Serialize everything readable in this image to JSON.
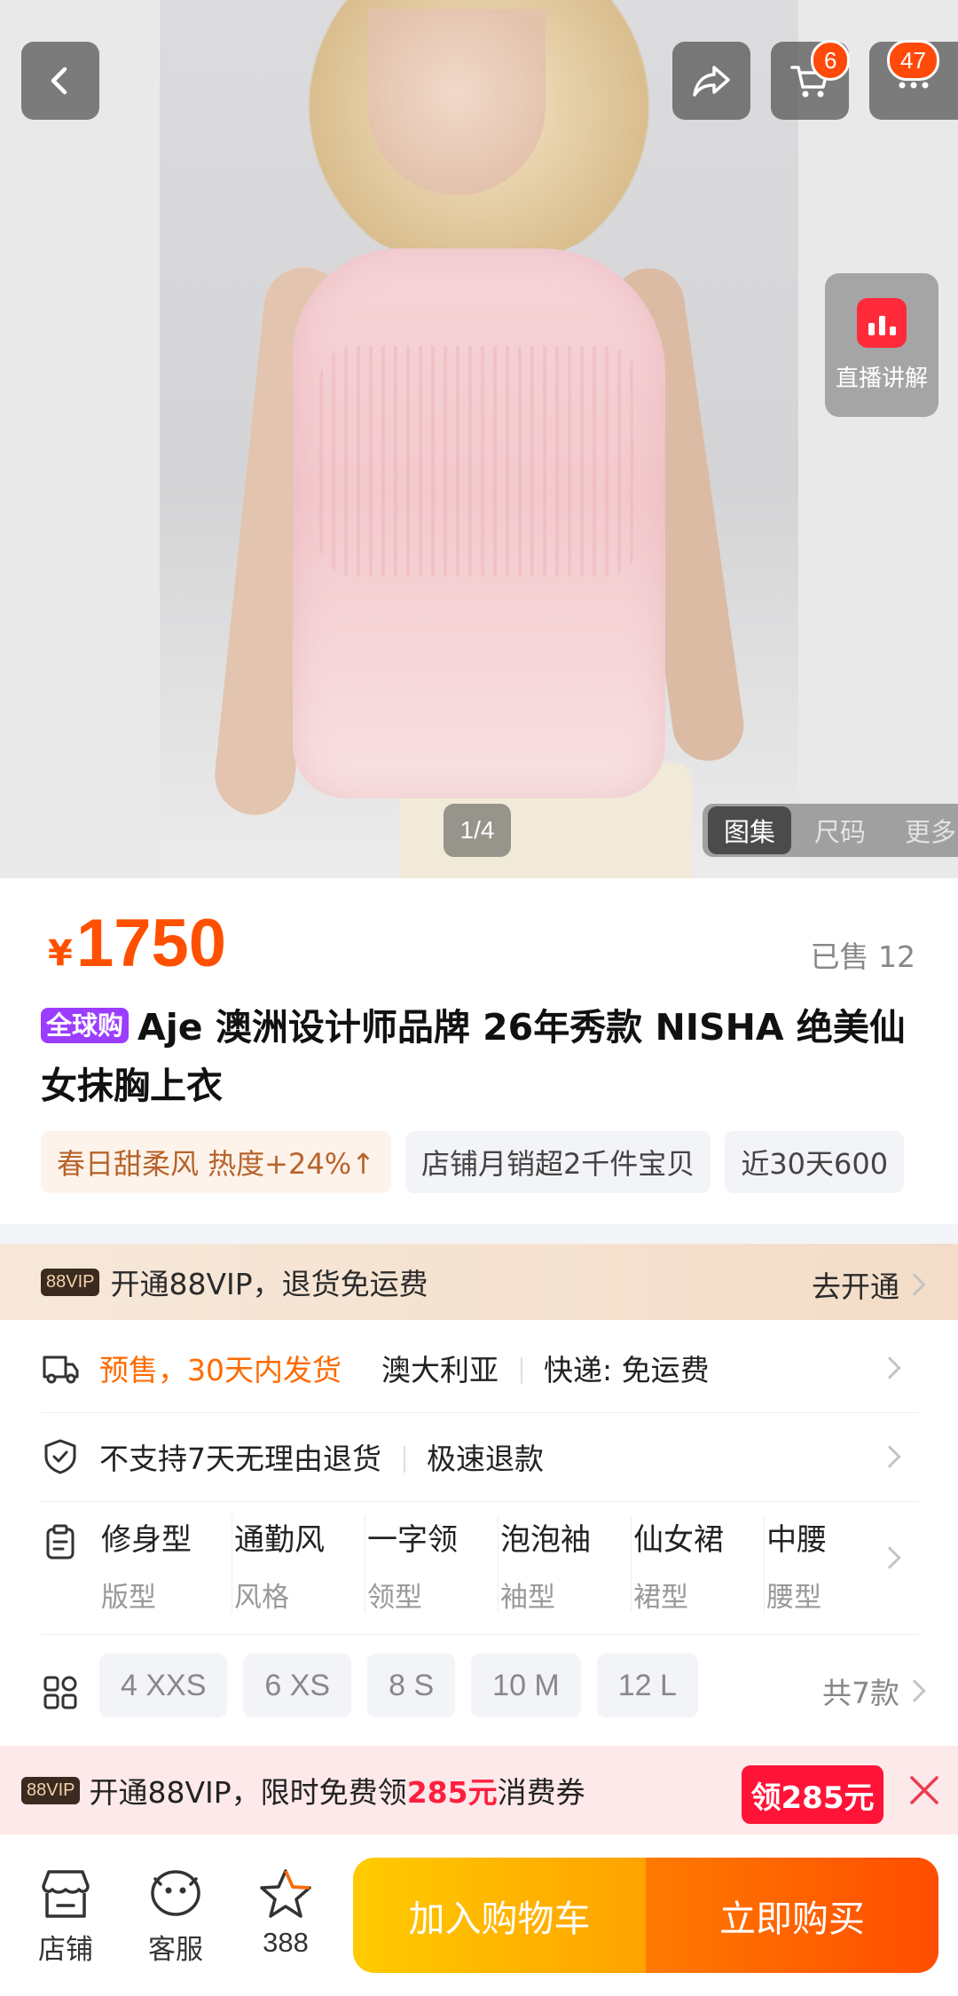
{
  "gallery": {
    "page_counter": "1/4",
    "tabs": [
      "图集",
      "尺码",
      "更多"
    ],
    "live_label": "直播讲解",
    "cart_badge": "6",
    "more_badge": "47"
  },
  "product": {
    "price_symbol": "¥",
    "price": "1750",
    "sold": "已售 12",
    "global_tag": "全球购",
    "title": "Aje 澳洲设计师品牌 26年秀款 NISHA 绝美仙女抹胸上衣",
    "chips": [
      "春日甜柔风 热度+24%↑",
      "店铺月销超2千件宝贝",
      "近30天600"
    ]
  },
  "vip_banner": {
    "logo": "88VIP",
    "text": "开通88VIP，退货免运费",
    "action": "去开通"
  },
  "shipping": {
    "presale": "预售，30天内发货",
    "origin": "澳大利亚",
    "delivery": "快递: 免运费"
  },
  "returns": {
    "policy": "不支持7天无理由退货",
    "refund": "极速退款"
  },
  "specs": [
    {
      "value": "修身型",
      "key": "版型"
    },
    {
      "value": "通勤风",
      "key": "风格"
    },
    {
      "value": "一字领",
      "key": "领型"
    },
    {
      "value": "泡泡袖",
      "key": "袖型"
    },
    {
      "value": "仙女裙",
      "key": "裙型"
    },
    {
      "value": "中腰",
      "key": "腰型"
    }
  ],
  "sizes": {
    "options": [
      "4 XXS",
      "6 XS",
      "8 S",
      "10 M",
      "12 L"
    ],
    "total": "共7款"
  },
  "coupon": {
    "logo": "88VIP",
    "text_before": "开通88VIP，限时免费领",
    "amount": "285元",
    "text_after": "消费券",
    "button": "领285元"
  },
  "bottom_bar": {
    "store": "店铺",
    "service": "客服",
    "favorites": "388",
    "add_to_cart": "加入购物车",
    "buy_now": "立即购买"
  },
  "colors": {
    "accent": "#ff5000",
    "cart_button": "#ffb300",
    "buy_button": "#ff5a00",
    "global_tag": "#9b3dff",
    "coupon_red": "#ff1438"
  },
  "icons": [
    "back-icon",
    "share-icon",
    "cart-icon",
    "more-icon",
    "live-icon",
    "truck-icon",
    "shield-check-icon",
    "clipboard-icon",
    "grid-icon",
    "close-icon",
    "store-icon",
    "chat-icon",
    "star-icon"
  ]
}
